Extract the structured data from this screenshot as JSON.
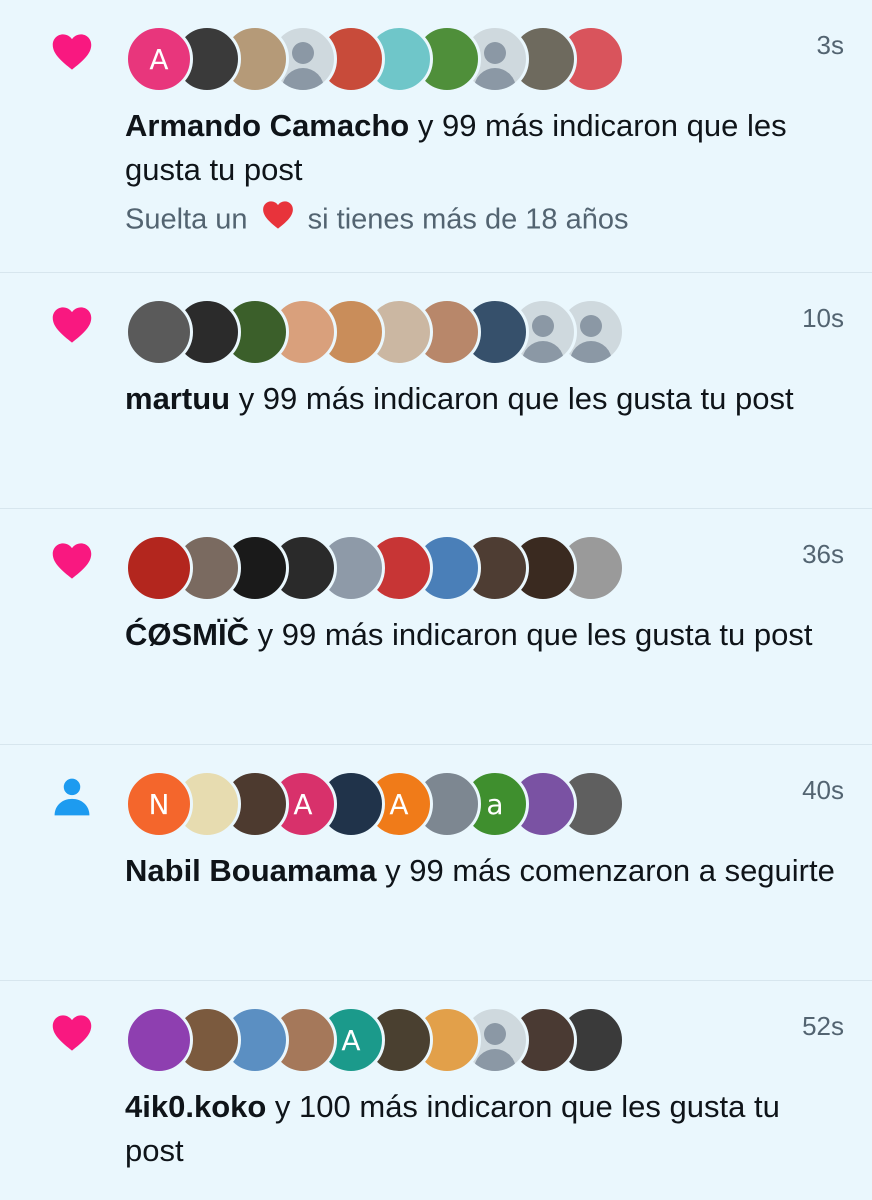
{
  "colors": {
    "like_heart": "#f91880",
    "follow_icon": "#1d9bf0",
    "text": "#0f1419",
    "muted": "#536471",
    "background": "#eaf7fd"
  },
  "notifications": [
    {
      "type": "like",
      "icon": "heart-icon",
      "time": "3s",
      "name": "Armando Camacho",
      "action": " y 99 más indicaron que les gusta tu post",
      "preview_before": "Suelta un ",
      "preview_emoji": "red-heart-emoji",
      "preview_after": " si tienes más de 18 años",
      "avatars": [
        {
          "letter": "A",
          "color": "#e8367c"
        },
        {
          "letter": "",
          "color": "#3a3a3a"
        },
        {
          "letter": "",
          "color": "#b59a78"
        },
        {
          "letter": "",
          "color": "default"
        },
        {
          "letter": "",
          "color": "#c84b3a"
        },
        {
          "letter": "",
          "color": "#6fc6c9"
        },
        {
          "letter": "",
          "color": "#4f8f3a"
        },
        {
          "letter": "",
          "color": "default"
        },
        {
          "letter": "",
          "color": "#6e6a5e"
        },
        {
          "letter": "",
          "color": "#d9545c"
        }
      ]
    },
    {
      "type": "like",
      "icon": "heart-icon",
      "time": "10s",
      "name": "martuu",
      "action": " y 99 más indicaron que les gusta tu post",
      "avatars": [
        {
          "letter": "",
          "color": "#5a5a5a"
        },
        {
          "letter": "",
          "color": "#2b2b2b"
        },
        {
          "letter": "",
          "color": "#3b5f2a"
        },
        {
          "letter": "",
          "color": "#d9a07c"
        },
        {
          "letter": "",
          "color": "#c98d5a"
        },
        {
          "letter": "",
          "color": "#cbb7a2"
        },
        {
          "letter": "",
          "color": "#b8876a"
        },
        {
          "letter": "",
          "color": "#36506b"
        },
        {
          "letter": "",
          "color": "default"
        },
        {
          "letter": "",
          "color": "default"
        }
      ]
    },
    {
      "type": "like",
      "icon": "heart-icon",
      "time": "36s",
      "name": "ĆØSMÏČ",
      "action": " y 99 más indicaron que les gusta tu post",
      "avatars": [
        {
          "letter": "",
          "color": "#b3261e"
        },
        {
          "letter": "",
          "color": "#7a6a60"
        },
        {
          "letter": "",
          "color": "#1a1a1a"
        },
        {
          "letter": "",
          "color": "#2a2a2a"
        },
        {
          "letter": "",
          "color": "#8e9aa8"
        },
        {
          "letter": "",
          "color": "#c73535"
        },
        {
          "letter": "",
          "color": "#4a7fb8"
        },
        {
          "letter": "",
          "color": "#4e3d33"
        },
        {
          "letter": "",
          "color": "#3a2a20"
        },
        {
          "letter": "",
          "color": "#9a9a9a"
        }
      ]
    },
    {
      "type": "follow",
      "icon": "person-icon",
      "time": "40s",
      "name": "Nabil Bouamama",
      "action": " y 99 más comenzaron a seguirte",
      "avatars": [
        {
          "letter": "N",
          "color": "#f4662c"
        },
        {
          "letter": "",
          "color": "#e7dcb0"
        },
        {
          "letter": "",
          "color": "#4d3a2f"
        },
        {
          "letter": "A",
          "color": "#d8316b"
        },
        {
          "letter": "",
          "color": "#20334a"
        },
        {
          "letter": "A",
          "color": "#f07b19"
        },
        {
          "letter": "",
          "color": "#7d8791"
        },
        {
          "letter": "a",
          "color": "#3f8f2e"
        },
        {
          "letter": "",
          "color": "#7a52a3"
        },
        {
          "letter": "",
          "color": "#5f5f5f"
        }
      ]
    },
    {
      "type": "like",
      "icon": "heart-icon",
      "time": "52s",
      "name": "4ik0.koko",
      "action": " y 100 más indicaron que les gusta tu post",
      "avatars": [
        {
          "letter": "",
          "color": "#8e3fb0"
        },
        {
          "letter": "",
          "color": "#7b5a3e"
        },
        {
          "letter": "",
          "color": "#5b8fc2"
        },
        {
          "letter": "",
          "color": "#a5785a"
        },
        {
          "letter": "A",
          "color": "#1b9a8b"
        },
        {
          "letter": "",
          "color": "#4a4030"
        },
        {
          "letter": "",
          "color": "#e2a04a"
        },
        {
          "letter": "",
          "color": "default"
        },
        {
          "letter": "",
          "color": "#4a3a33"
        },
        {
          "letter": "",
          "color": "#3a3a3a"
        }
      ]
    }
  ]
}
